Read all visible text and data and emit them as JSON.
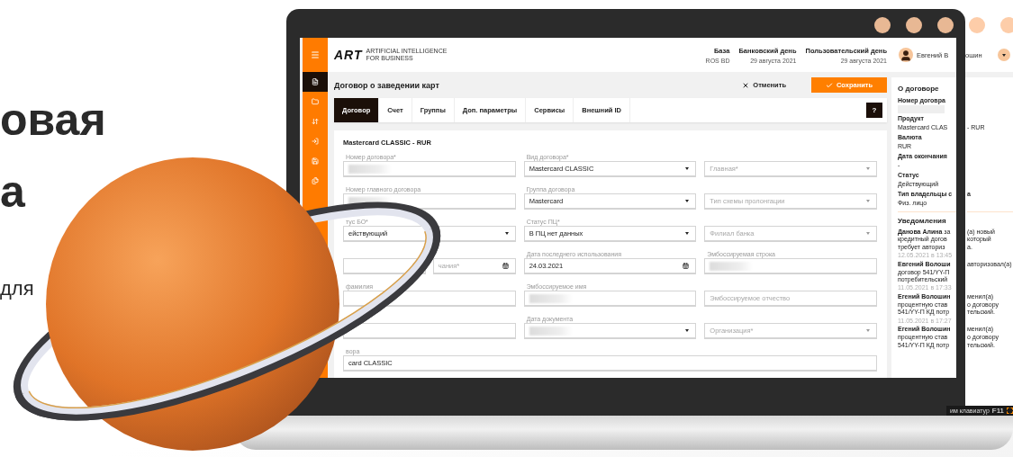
{
  "hero": {
    "lines": [
      {
        "kind": "headline",
        "text": "овая"
      },
      {
        "kind": "headline",
        "text": "а"
      },
      {
        "kind": "body",
        "text": "для"
      }
    ]
  },
  "app": {
    "logo": {
      "mark": "ART",
      "tagline_1": "ARTIFICIAL INTELLIGENCE",
      "tagline_2": "FOR BUSINESS"
    },
    "header_info": [
      {
        "label": "База",
        "value": "ROS BD"
      },
      {
        "label": "Банковский день",
        "value": "29 августа 2021"
      },
      {
        "label": "Пользовательский день",
        "value": "29 августа 2021"
      }
    ],
    "user": {
      "name_left": "Евгений В",
      "name_right": "ошин"
    },
    "nav": [
      {
        "selected": false
      },
      {
        "selected": true
      },
      {
        "selected": false
      },
      {
        "selected": false
      },
      {
        "selected": false
      },
      {
        "selected": false
      },
      {
        "selected": false
      }
    ],
    "page_title": "Договор о заведении карт",
    "actions": {
      "cancel": "Отменить",
      "save": "Сохранить"
    },
    "tabs": [
      {
        "label": "Договор",
        "selected": true
      },
      {
        "label": "Счет",
        "selected": false
      },
      {
        "label": "Группы",
        "selected": false
      },
      {
        "label": "Доп. параметры",
        "selected": false
      },
      {
        "label": "Сервисы",
        "selected": false
      },
      {
        "label": "Внешний ID",
        "selected": false
      }
    ],
    "help": "?",
    "form": {
      "title": "Mastercard CLASSIC - RUR",
      "rows": [
        [
          {
            "kind": "text",
            "label": "Номер договора*",
            "value_hidden": true
          },
          {
            "kind": "select",
            "label": "Вид договора*",
            "value": "Mastercard CLASSIC",
            "value_hidden": false
          },
          {
            "kind": "select",
            "placeholder": "Главная*",
            "value_hidden": false
          }
        ],
        [
          {
            "kind": "text",
            "label": "Номер главного договора",
            "value_hidden": true
          },
          {
            "kind": "select",
            "label": "Группа договора",
            "value": "Mastercard",
            "value_hidden": false
          },
          {
            "kind": "select",
            "placeholder": "Тип схемы пролонгации",
            "value_hidden": false
          }
        ],
        [
          {
            "kind": "select",
            "label": "тус БО*",
            "value": "ействующий",
            "value_hidden": false
          },
          {
            "kind": "select",
            "label": "Статус ПЦ*",
            "value": "В ПЦ нет данных",
            "value_hidden": false
          },
          {
            "kind": "select",
            "placeholder": "Филиал банка",
            "value_hidden": false
          }
        ],
        [
          {
            "kind": "split",
            "parts": [
              {
                "kind": "date",
                "value_hidden": false
              },
              {
                "kind": "date",
                "placeholder": "чания*",
                "value_hidden": false
              }
            ]
          },
          {
            "kind": "date",
            "label": "Дата последнего использования",
            "value": "24.03.2021",
            "value_hidden": false
          },
          {
            "kind": "text",
            "label": "Эмбоссируемая строка",
            "value_hidden": true
          }
        ],
        [
          {
            "kind": "text",
            "label": "фамилия",
            "value_hidden": false
          },
          {
            "kind": "text",
            "label": "Эмбоссируемое имя",
            "value_hidden": true
          },
          {
            "kind": "text",
            "placeholder": "Эмбоссируемое отчество",
            "value_hidden": false
          }
        ],
        [
          {
            "kind": "text",
            "value_hidden": false
          },
          {
            "kind": "select",
            "label": "Дата документа",
            "value_hidden": true
          },
          {
            "kind": "select",
            "placeholder": "Организация*",
            "value_hidden": false
          }
        ],
        [
          {
            "kind": "text",
            "label": "вора",
            "value": "card CLASSIC",
            "value_hidden": false
          }
        ]
      ]
    },
    "sidebar": {
      "lines": [
        {
          "kind": "heading",
          "left": "О договоре"
        },
        {
          "kind": "label",
          "left": "Номер договра"
        },
        {
          "kind": "blurred"
        },
        {
          "kind": "label",
          "left": "Продукт"
        },
        {
          "kind": "value",
          "left": "Mastercard CLAS",
          "right": "- RUR"
        },
        {
          "kind": "label",
          "left": "Валюта"
        },
        {
          "kind": "value",
          "left": "RUR"
        },
        {
          "kind": "label",
          "left": "Дата окончания"
        },
        {
          "kind": "value",
          "left": "-"
        },
        {
          "kind": "label",
          "left": "Статус"
        },
        {
          "kind": "value",
          "left": "Действующий"
        },
        {
          "kind": "label",
          "left": "Тип владельцы с",
          "right": "а"
        },
        {
          "kind": "value",
          "left": "Физ. лицо"
        },
        {
          "kind": "divider"
        },
        {
          "kind": "heading",
          "left": "Уведомления"
        },
        {
          "kind": "text",
          "left": "**Данова Алина** за",
          "right": "(а) новый"
        },
        {
          "kind": "text",
          "left": "кредитный догов",
          "right": "который"
        },
        {
          "kind": "text",
          "left": "требует авториз",
          "right": "а."
        },
        {
          "kind": "time",
          "left": "12.05.2021 в 13:45"
        },
        {
          "kind": "name",
          "left": "Евгений Волоши",
          "right": "авторизовал(а)"
        },
        {
          "kind": "text",
          "left": "договор 541/YY-П"
        },
        {
          "kind": "text",
          "left": "потребительский"
        },
        {
          "kind": "time",
          "left": "11.05.2021 в 17:33"
        },
        {
          "kind": "name",
          "left": "Егений Волошин",
          "right": "менил(а)"
        },
        {
          "kind": "text",
          "left": "процентную став",
          "right": "о договору"
        },
        {
          "kind": "text",
          "left": "541/YY-П КД потр",
          "right": "тельский."
        },
        {
          "kind": "time",
          "left": "11.05.2021 в 17:27"
        },
        {
          "kind": "name",
          "left": "Егений Волошин",
          "right": "менил(а)"
        },
        {
          "kind": "text",
          "left": "процентную став",
          "right": "о договору"
        },
        {
          "kind": "text",
          "left": "541/YY-П КД потр",
          "right": "тельский."
        }
      ]
    },
    "status_bar": {
      "text": "им клавиатур",
      "key": "F11"
    }
  }
}
